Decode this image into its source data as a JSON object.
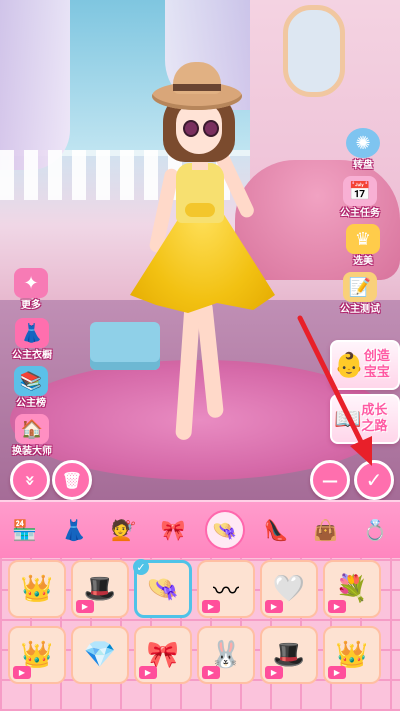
{
  "left_menu": [
    {
      "label": "更多",
      "icon": "more-icon",
      "color": "#f77bb5"
    },
    {
      "label": "公主衣橱",
      "icon": "wardrobe-icon",
      "color": "#ff6fae"
    },
    {
      "label": "公主榜",
      "icon": "ranking-book-icon",
      "color": "#5bc0e8"
    },
    {
      "label": "换装大师",
      "icon": "dress-master-icon",
      "color": "#ff8fc2"
    }
  ],
  "right_menu": [
    {
      "label": "转盘",
      "icon": "wheel-icon",
      "color": "#7ec4f0"
    },
    {
      "label": "公主任务",
      "icon": "task-icon",
      "color": "#f8b0d4"
    },
    {
      "label": "选美",
      "icon": "crown-icon",
      "color": "#ffcc4a"
    },
    {
      "label": "公主测试",
      "icon": "test-icon",
      "color": "#f9d07a"
    }
  ],
  "banners": [
    {
      "line1": "创造",
      "line2": "宝宝",
      "icon": "baby-icon"
    },
    {
      "line1": "成长",
      "line2": "之路",
      "icon": "growth-book-icon"
    }
  ],
  "buttons": {
    "collapse": "»",
    "trash": "🗑",
    "remove": "—",
    "confirm": "✓"
  },
  "colors": {
    "accent_pink": "#ff86bf",
    "selected_border": "#4fc3e8",
    "arrow_red": "#e8202a"
  },
  "tabs": [
    {
      "icon": "shop-icon",
      "glyph": "🏪"
    },
    {
      "icon": "dress-icon",
      "glyph": "👗"
    },
    {
      "icon": "hair-icon",
      "glyph": "💇"
    },
    {
      "icon": "hair-accessory-icon",
      "glyph": "🎀"
    },
    {
      "icon": "hat-icon",
      "glyph": "👒",
      "active": true
    },
    {
      "icon": "shoes-icon",
      "glyph": "👠"
    },
    {
      "icon": "bag-icon",
      "glyph": "👜"
    },
    {
      "icon": "necklace-icon",
      "glyph": "💍"
    }
  ],
  "items": [
    {
      "icon": "tiara-icon",
      "glyph": "👑",
      "video": false
    },
    {
      "icon": "brown-hat-icon",
      "glyph": "🎩",
      "video": true
    },
    {
      "icon": "straw-hat-icon",
      "glyph": "👒",
      "video": false,
      "selected": true
    },
    {
      "icon": "headband-icon",
      "glyph": "〰",
      "video": true
    },
    {
      "icon": "veil-icon",
      "glyph": "🤍",
      "video": true
    },
    {
      "icon": "flower-crown-icon",
      "glyph": "💐",
      "video": true
    },
    {
      "icon": "purple-crown-icon",
      "glyph": "👑",
      "video": true
    },
    {
      "icon": "crystal-tiara-icon",
      "glyph": "💎",
      "video": false
    },
    {
      "icon": "bow-headband-icon",
      "glyph": "🎀",
      "video": true
    },
    {
      "icon": "bunny-ears-icon",
      "glyph": "🐰",
      "video": true
    },
    {
      "icon": "black-hat-icon",
      "glyph": "🎩",
      "video": true
    },
    {
      "icon": "gold-crown-icon",
      "glyph": "👑",
      "video": true
    }
  ]
}
